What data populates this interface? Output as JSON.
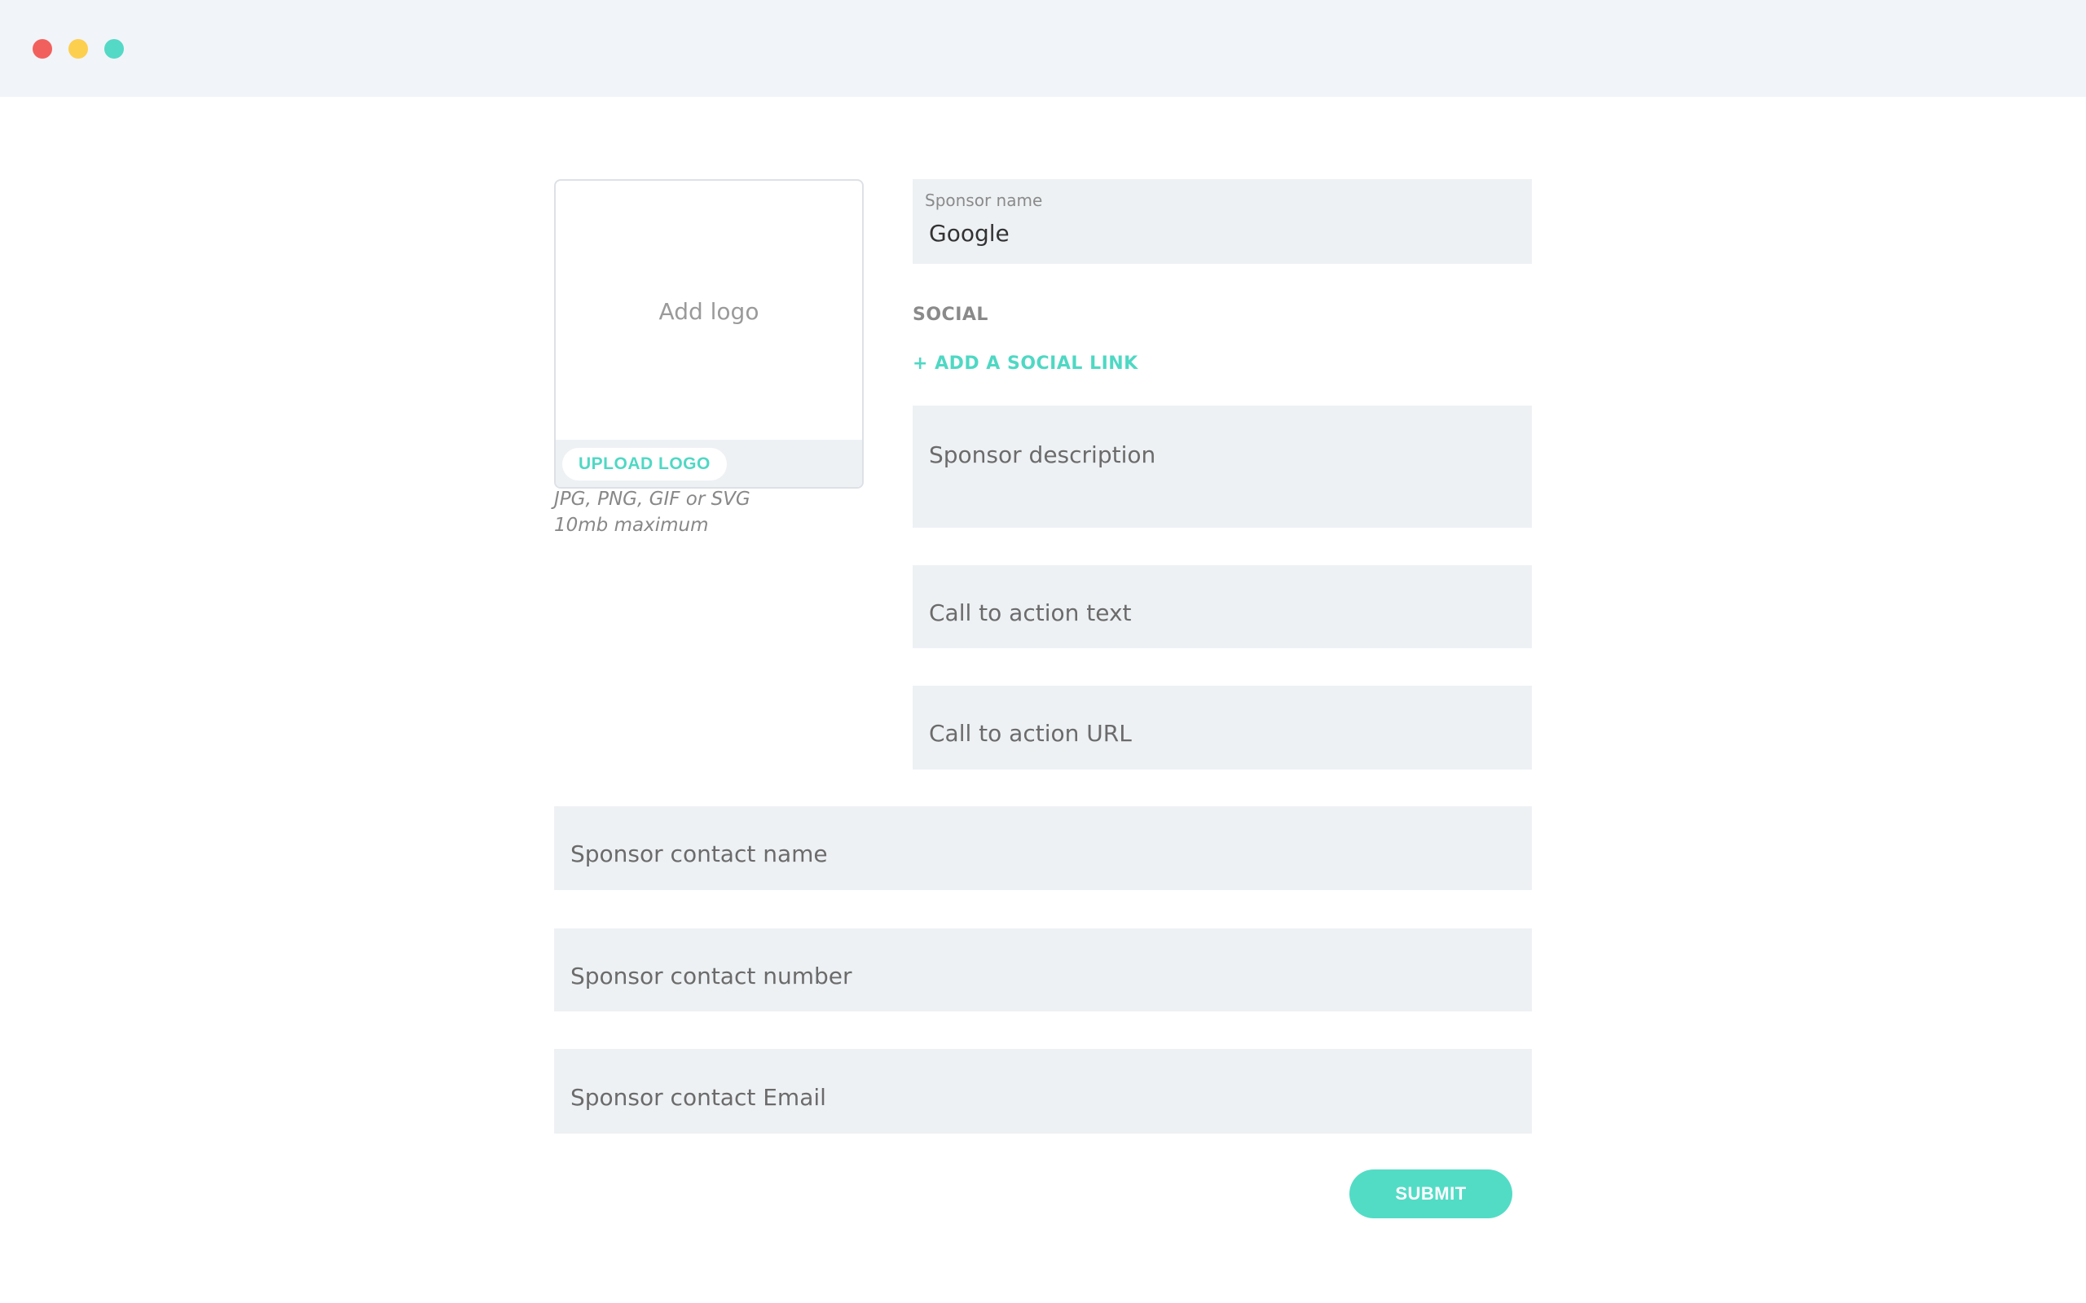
{
  "window": {
    "controls": {
      "close_color": "#f2605d",
      "minimize_color": "#fdcf4f",
      "maximize_color": "#54d9c6"
    }
  },
  "logo": {
    "placeholder": "Add logo",
    "upload_label": "UPLOAD LOGO",
    "formats_note": "JPG, PNG, GIF or SVG",
    "size_note": "10mb maximum"
  },
  "form": {
    "sponsor_name": {
      "label": "Sponsor name",
      "value": "Google"
    },
    "social": {
      "section_label": "SOCIAL",
      "add_link_label": "+ ADD A SOCIAL LINK"
    },
    "description": {
      "placeholder": "Sponsor description"
    },
    "cta_text": {
      "placeholder": "Call to action text"
    },
    "cta_url": {
      "placeholder": "Call to action URL"
    },
    "contact_name": {
      "placeholder": "Sponsor contact name"
    },
    "contact_number": {
      "placeholder": "Sponsor contact number"
    },
    "contact_email": {
      "placeholder": "Sponsor contact Email"
    },
    "submit_label": "SUBMIT"
  },
  "colors": {
    "accent": "#52dcc5",
    "field_bg": "#eef1f4",
    "titlebar_bg": "#f1f4f8"
  }
}
